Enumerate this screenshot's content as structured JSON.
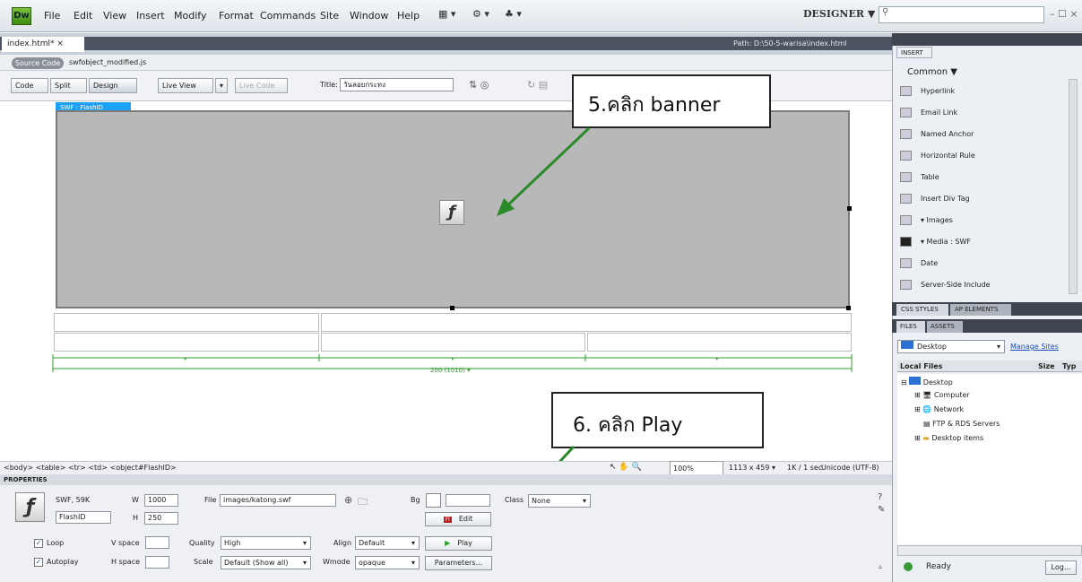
{
  "app": {
    "logo": "Dw",
    "menu": [
      "File",
      "Edit",
      "View",
      "Insert",
      "Modify",
      "Format",
      "Commands",
      "Site",
      "Window",
      "Help"
    ],
    "workspace": "DESIGNER ▼",
    "window_controls": "– ☐ ×"
  },
  "doc": {
    "tab": "index.html* ×",
    "path": "Path: D:\\50-5-warisa\\index.html",
    "source_code": "Source Code",
    "related_file": "swfobject_modified.js"
  },
  "toolbar": {
    "code": "Code",
    "split": "Split",
    "design": "Design",
    "live_view": "Live View",
    "live_code": "Live Code",
    "title_label": "Title:",
    "title_value": "วันลอยกระทง"
  },
  "design": {
    "swf_label": "SWF : FlashID",
    "flash_icon": "ƒ",
    "measure": "200 (1010) ▾"
  },
  "callouts": {
    "step5": "5.คลิก banner",
    "step6": "6. คลิก Play"
  },
  "status": {
    "tags": "<body> <table> <tr> <td> <object#FlashID>",
    "zoom": "100%",
    "size": "1113 x 459 ▾",
    "speed": "1K / 1 sec",
    "encoding": "Unicode (UTF-8)"
  },
  "props": {
    "title": "PROPERTIES",
    "swf_info": "SWF, 59K",
    "id": "FlashID",
    "w_label": "W",
    "w": "1000",
    "h_label": "H",
    "h": "250",
    "file_label": "File",
    "file": "images/katong.swf",
    "bg_label": "Bg",
    "class_label": "Class",
    "class": "None",
    "edit": "Edit",
    "loop": "Loop",
    "autoplay": "Autoplay",
    "vspace": "V space",
    "hspace": "H space",
    "quality_label": "Quality",
    "quality": "High",
    "scale_label": "Scale",
    "scale": "Default (Show all)",
    "align_label": "Align",
    "align": "Default",
    "wmode_label": "Wmode",
    "wmode": "opaque",
    "play": "Play",
    "parameters": "Parameters..."
  },
  "panel": {
    "insert": "INSERT",
    "category": "Common ▼",
    "items": [
      "Hyperlink",
      "Email Link",
      "Named Anchor",
      "Horizontal Rule",
      "Table",
      "Insert Div Tag",
      "▾ Images",
      "▾ Media : SWF",
      "Date",
      "Server-Side Include"
    ],
    "css_tabs": [
      "CSS STYLES",
      "AP ELEMENTS"
    ],
    "files_tabs": [
      "FILES",
      "ASSETS"
    ],
    "location": "Desktop",
    "manage": "Manage Sites",
    "local_files": "Local Files",
    "size": "Size",
    "type": "Typ",
    "tree": [
      "Desktop",
      "Computer",
      "Network",
      "FTP & RDS Servers",
      "Desktop items"
    ],
    "ready": "Ready",
    "log": "Log..."
  }
}
